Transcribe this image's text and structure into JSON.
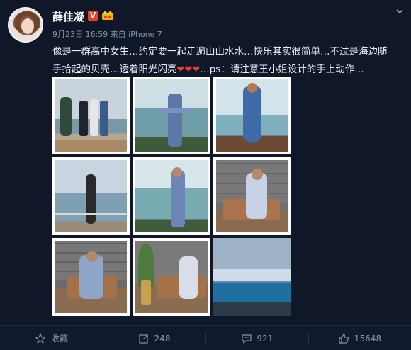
{
  "post": {
    "username": "薛佳凝",
    "verified_badge": "V",
    "meta": "9月23日 16:59 来自 iPhone 7",
    "text_line1": "像是一群高中女生…约定要一起走遍山山水水…快乐其实很简单…不过是海边随",
    "text_line2a": "手拾起的贝壳…透着阳光闪亮",
    "hearts": "❤❤❤",
    "text_line2b": "…ps：请注意王小姐设计的手上动作…"
  },
  "photos": [
    {
      "id": "photo-1"
    },
    {
      "id": "photo-2"
    },
    {
      "id": "photo-3"
    },
    {
      "id": "photo-4"
    },
    {
      "id": "photo-5"
    },
    {
      "id": "photo-6"
    },
    {
      "id": "photo-7"
    },
    {
      "id": "photo-8"
    },
    {
      "id": "photo-9"
    }
  ],
  "actions": {
    "favorite_label": "收藏",
    "repost_count": "248",
    "comment_count": "921",
    "like_count": "15648"
  },
  "colors": {
    "background": "#0f1729",
    "verified": "#e8421e",
    "heart": "#ef3b2c",
    "muted_text": "#8a94a7"
  },
  "icons": [
    "star-icon",
    "repost-icon",
    "comment-icon",
    "thumbs-up-icon",
    "chevron-down-icon",
    "crown-badge-icon"
  ]
}
